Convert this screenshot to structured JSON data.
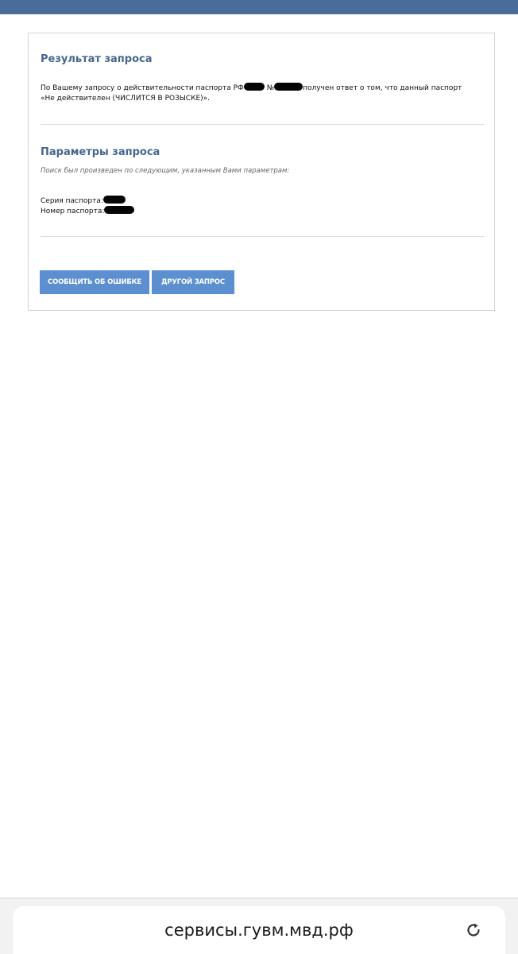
{
  "result": {
    "title": "Результат запроса",
    "text_part1": "По Вашему запросу о действительности паспорта РФ",
    "text_number_sign": "№",
    "text_part2": "получен ответ о том, что данный паспорт «Не действителен (ЧИСЛИТСЯ В РОЗЫСКЕ)»."
  },
  "params": {
    "title": "Параметры запроса",
    "note": "Поиск был произведен по следующим, указанным Вами параметрам:",
    "series_label": "Серия паспорта:",
    "number_label": "Номер паспорта:"
  },
  "buttons": {
    "report_error": "СООБЩИТЬ ОБ ОШИБКЕ",
    "new_request": "ДРУГОЙ ЗАПРОС"
  },
  "browser": {
    "url": "сервисы.гувм.мвд.рф",
    "reload_icon": "reload-icon"
  },
  "colors": {
    "header_bar": "#4a6c98",
    "title": "#45678f",
    "button": "#5b8fcf"
  }
}
